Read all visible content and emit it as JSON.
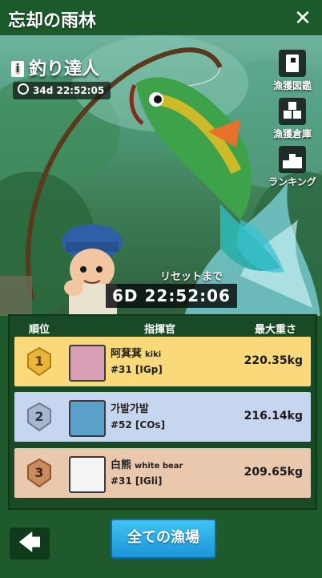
{
  "header": {
    "title": "忘却の雨林",
    "close_glyph": "✕"
  },
  "event": {
    "info_glyph": "i",
    "title": "釣り達人",
    "timer_small": "34d 22:52:05"
  },
  "side_menu": [
    {
      "label": "漁獲図鑑",
      "icon": "book-icon"
    },
    {
      "label": "漁獲倉庫",
      "icon": "crates-icon"
    },
    {
      "label": "ランキング",
      "icon": "podium-icon"
    }
  ],
  "reset": {
    "label": "リセットまで",
    "timer": "6D 22:52:06"
  },
  "table": {
    "headers": {
      "rank": "順位",
      "commander": "指揮官",
      "max_weight": "最大重さ"
    },
    "rows": [
      {
        "rank": "1",
        "name": "阿萁萁",
        "alias": "kiki",
        "tag": "#31 [IGp]",
        "weight": "220.35kg",
        "bg": "#f9d97a",
        "badge_color": "#e9b63a"
      },
      {
        "rank": "2",
        "name": "가발가발",
        "alias": "",
        "tag": "#52 [COs]",
        "weight": "216.14kg",
        "bg": "#c6d6ef",
        "badge_color": "#a9b7cc"
      },
      {
        "rank": "3",
        "name": "白熊",
        "alias": "white bear",
        "tag": "#31 [IGli]",
        "weight": "209.65kg",
        "bg": "#e9c8ae",
        "badge_color": "#c98c5e"
      }
    ]
  },
  "footer": {
    "back_glyph": "🡄",
    "all_fishing_label": "全ての漁場"
  },
  "colors": {
    "accent": "#1c96d8",
    "panel": "#184a26",
    "header_green": "#1b5a2a"
  }
}
